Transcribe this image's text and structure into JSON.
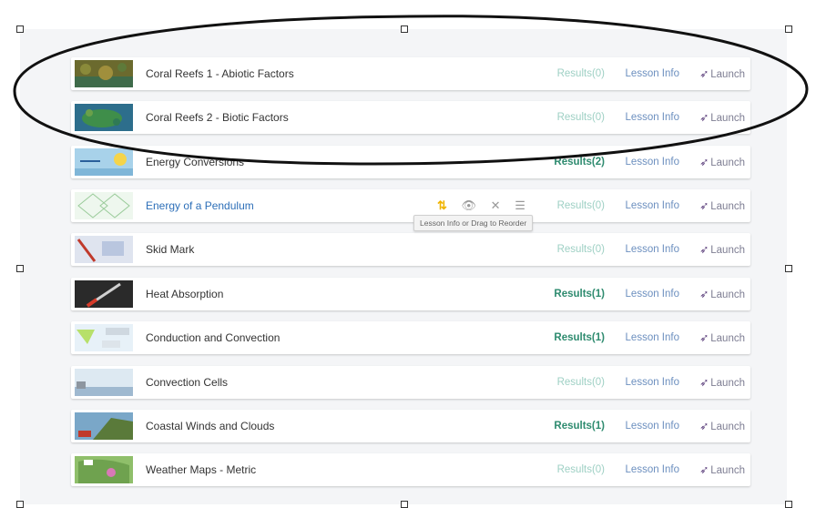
{
  "lessons": [
    {
      "title": "Coral Reefs 1 - Abiotic Factors",
      "results": "Results(0)",
      "info": "Lesson Info",
      "launch": "Launch"
    },
    {
      "title": "Coral Reefs 2 - Biotic Factors",
      "results": "Results(0)",
      "info": "Lesson Info",
      "launch": "Launch"
    },
    {
      "title": "Energy Conversions",
      "results": "Results(2)",
      "info": "Lesson Info",
      "launch": "Launch"
    },
    {
      "title": "Energy of a Pendulum",
      "results": "Results(0)",
      "info": "Lesson Info",
      "launch": "Launch"
    },
    {
      "title": "Skid Mark",
      "results": "Results(0)",
      "info": "Lesson Info",
      "launch": "Launch"
    },
    {
      "title": "Heat Absorption",
      "results": "Results(1)",
      "info": "Lesson Info",
      "launch": "Launch"
    },
    {
      "title": "Conduction and Convection",
      "results": "Results(1)",
      "info": "Lesson Info",
      "launch": "Launch"
    },
    {
      "title": "Convection Cells",
      "results": "Results(0)",
      "info": "Lesson Info",
      "launch": "Launch"
    },
    {
      "title": "Coastal Winds and Clouds",
      "results": "Results(1)",
      "info": "Lesson Info",
      "launch": "Launch"
    },
    {
      "title": "Weather Maps - Metric",
      "results": "Results(0)",
      "info": "Lesson Info",
      "launch": "Launch"
    }
  ],
  "tooltip": "Lesson Info or Drag to Reorder",
  "icons": {
    "sort": "sort-icon",
    "preview": "eye-icon",
    "delete": "close-icon",
    "drag": "drag-handle-icon",
    "launch": "rocket-icon"
  },
  "colors": {
    "link": "#2d6fb8",
    "results_active": "#2e8b6f",
    "results_inactive": "#9ed0c4",
    "lesson_info": "#6c8fbf",
    "launch_icon": "#5a3d7a",
    "sort_icon": "#f0b400"
  }
}
